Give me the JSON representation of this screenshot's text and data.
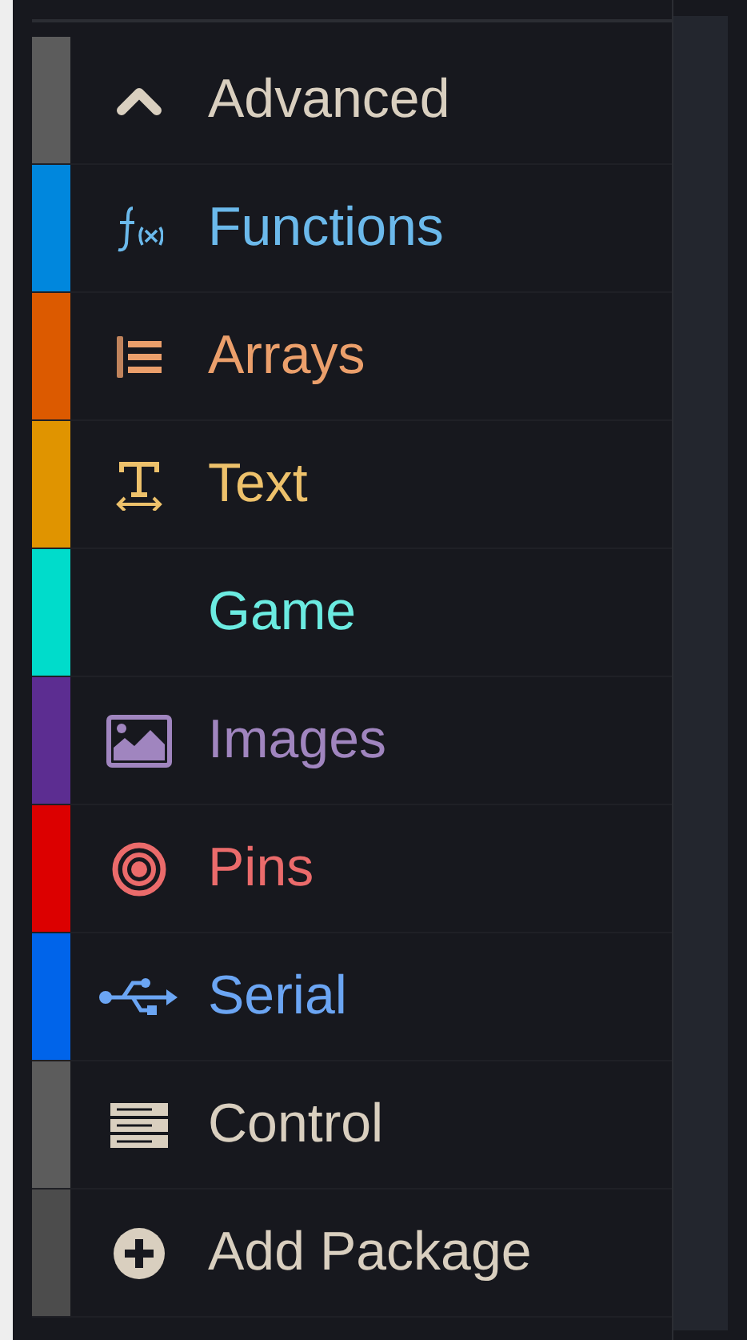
{
  "toolbox": {
    "categories": [
      {
        "label": "Advanced",
        "kind": "toggle",
        "expanded": true,
        "color": "#5c5c5c"
      },
      {
        "label": "Functions",
        "kind": "function",
        "color": "#0087dd"
      },
      {
        "label": "Arrays",
        "kind": "list",
        "color": "#dc5a00"
      },
      {
        "label": "Text",
        "kind": "text",
        "color": "#e09400"
      },
      {
        "label": "Game",
        "kind": "none",
        "color": "#00dccb"
      },
      {
        "label": "Images",
        "kind": "image",
        "color": "#5c2d91"
      },
      {
        "label": "Pins",
        "kind": "target",
        "color": "#dc0000"
      },
      {
        "label": "Serial",
        "kind": "usb",
        "color": "#0064ea"
      },
      {
        "label": "Control",
        "kind": "server",
        "color": "#5c5c5c"
      },
      {
        "label": "Add Package",
        "kind": "add",
        "color": "#4c4c4c"
      }
    ]
  }
}
